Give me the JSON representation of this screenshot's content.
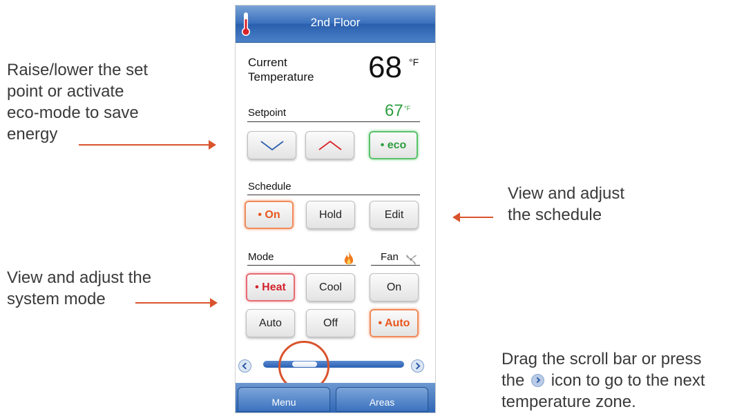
{
  "callouts": {
    "setpoint": [
      "Raise/lower the set",
      "point or activate",
      "eco-mode to save",
      "energy"
    ],
    "schedule": [
      "View and adjust",
      "the schedule"
    ],
    "mode": [
      "View and adjust the",
      "system mode"
    ],
    "scroll": {
      "line1": "Drag the scroll bar or press",
      "line2_before": "the",
      "line2_after": "icon to go to the next",
      "line3": "temperature zone."
    }
  },
  "header": {
    "title": "2nd Floor",
    "icon": "thermometer-icon"
  },
  "current": {
    "label_line1": "Current",
    "label_line2": "Temperature",
    "value": "68",
    "unit": "°F"
  },
  "setpoint": {
    "label": "Setpoint",
    "value": "67",
    "unit": "°F",
    "down_icon": "chevron-down-icon",
    "up_icon": "chevron-up-icon",
    "eco_label": "• eco"
  },
  "schedule": {
    "label": "Schedule",
    "on_label": "• On",
    "hold_label": "Hold",
    "edit_label": "Edit"
  },
  "mode": {
    "label": "Mode",
    "icon": "flame-icon",
    "heat_label": "• Heat",
    "cool_label": "Cool",
    "auto_label": "Auto",
    "off_label": "Off"
  },
  "fan": {
    "label": "Fan",
    "icon": "fan-icon",
    "on_label": "On",
    "auto_label": "• Auto"
  },
  "scrollbar": {
    "left_icon": "scroll-left-icon",
    "right_icon": "scroll-right-icon"
  },
  "footer": {
    "menu_label": "Menu",
    "areas_label": "Areas"
  },
  "colors": {
    "accent_blue": "#2a5fae",
    "eco_green": "#2e9e3f",
    "orange": "#e8561e",
    "heat_red": "#d2232e",
    "arrow": "#d9532c"
  }
}
